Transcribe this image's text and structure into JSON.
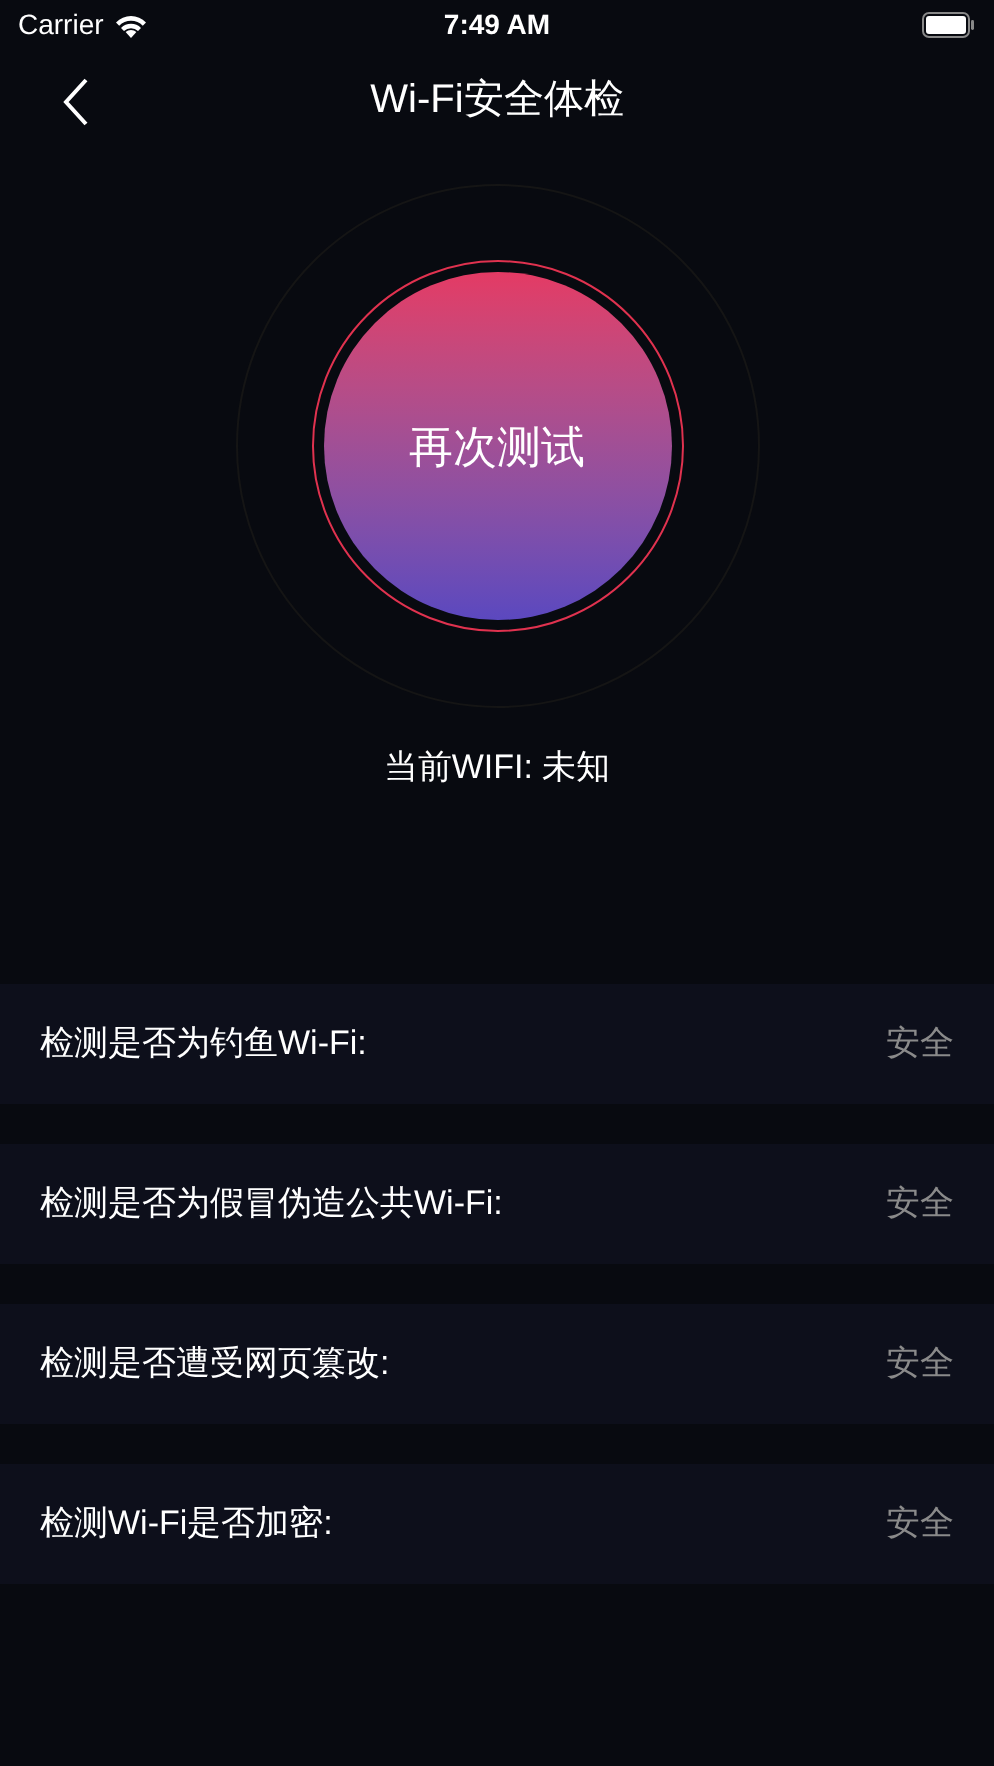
{
  "status_bar": {
    "carrier": "Carrier",
    "time": "7:49 AM"
  },
  "nav": {
    "title": "Wi-Fi安全体检"
  },
  "test_button": {
    "label": "再次测试"
  },
  "current_wifi": "当前WIFI: 未知",
  "checks": [
    {
      "label": "检测是否为钓鱼Wi-Fi:",
      "result": "安全"
    },
    {
      "label": "检测是否为假冒伪造公共Wi-Fi:",
      "result": "安全"
    },
    {
      "label": "检测是否遭受网页篡改:",
      "result": "安全"
    },
    {
      "label": "检测Wi-Fi是否加密:",
      "result": "安全"
    }
  ]
}
